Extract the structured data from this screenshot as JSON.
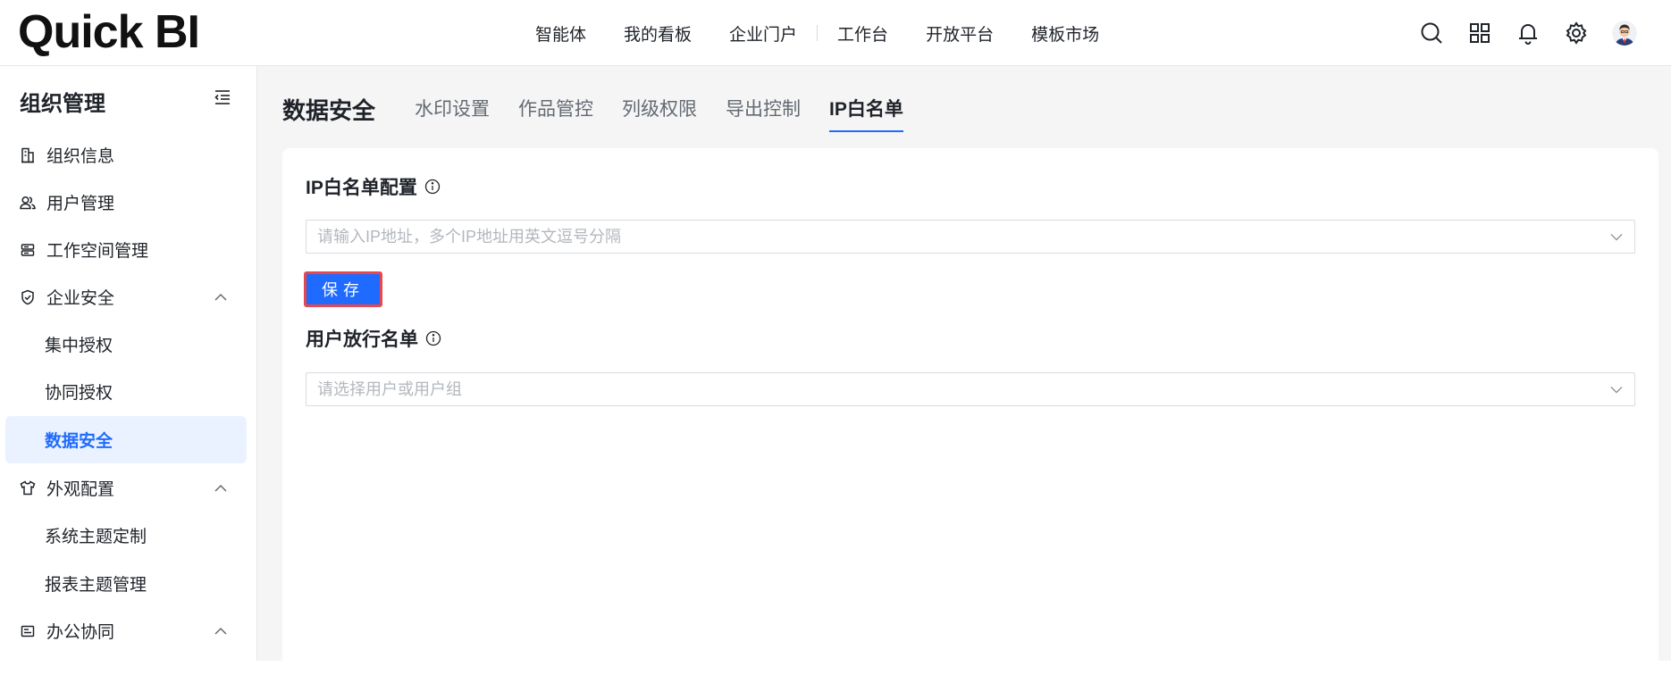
{
  "header": {
    "logo_text": "Quick BI",
    "nav": [
      "智能体",
      "我的看板",
      "企业门户",
      "工作台",
      "开放平台",
      "模板市场"
    ],
    "icons": [
      "search-icon",
      "apps-grid-icon",
      "bell-icon",
      "gear-icon",
      "user-avatar"
    ]
  },
  "sidebar": {
    "title": "组织管理",
    "items": [
      {
        "label": "组织信息",
        "icon": "building-icon"
      },
      {
        "label": "用户管理",
        "icon": "users-icon"
      },
      {
        "label": "工作空间管理",
        "icon": "workspace-icon"
      },
      {
        "label": "企业安全",
        "icon": "shield-icon",
        "expanded": true
      },
      {
        "label": "集中授权"
      },
      {
        "label": "协同授权"
      },
      {
        "label": "数据安全",
        "active": true
      },
      {
        "label": "外观配置",
        "icon": "shirt-icon",
        "expanded": true
      },
      {
        "label": "系统主题定制"
      },
      {
        "label": "报表主题管理"
      },
      {
        "label": "办公协同",
        "icon": "office-icon",
        "expanded": true
      }
    ]
  },
  "main": {
    "page_title": "数据安全",
    "tabs": [
      {
        "label": "水印设置"
      },
      {
        "label": "作品管控"
      },
      {
        "label": "列级权限"
      },
      {
        "label": "导出控制"
      },
      {
        "label": "IP白名单",
        "active": true
      }
    ],
    "ip_section": {
      "title": "IP白名单配置",
      "placeholder": "请输入IP地址，多个IP地址用英文逗号分隔",
      "save_label": "保存"
    },
    "user_section": {
      "title": "用户放行名单",
      "placeholder": "请选择用户或用户组"
    }
  },
  "colors": {
    "accent": "#1f6bff",
    "active_bg": "#ebf2ff",
    "highlight_border": "#e5484d"
  }
}
